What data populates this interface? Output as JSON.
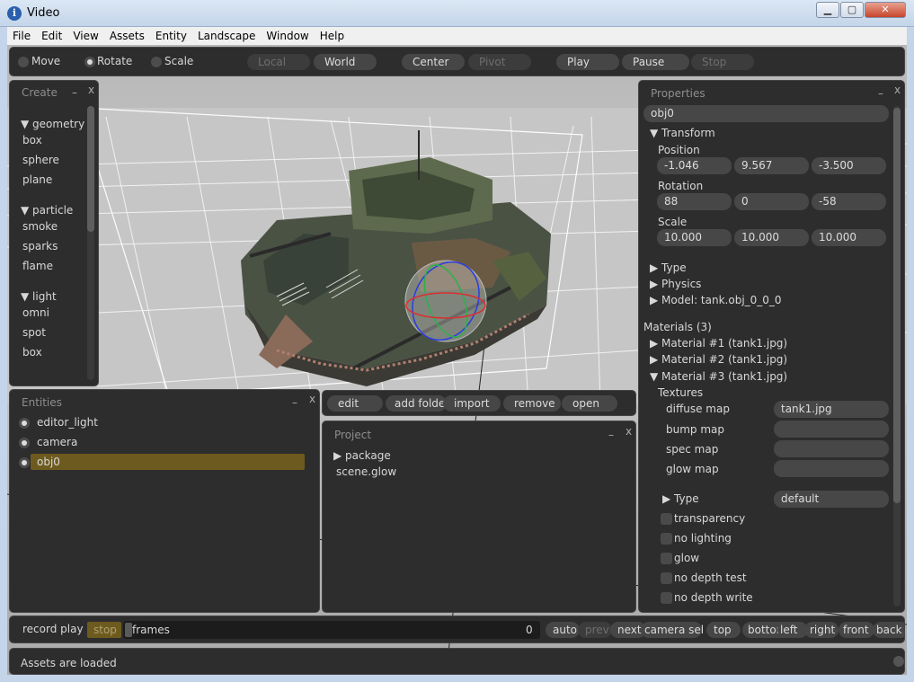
{
  "window": {
    "title": "Video",
    "min_label": "▁",
    "max_label": "▢",
    "close_label": "✕"
  },
  "menu": [
    "File",
    "Edit",
    "View",
    "Assets",
    "Entity",
    "Landscape",
    "Window",
    "Help"
  ],
  "toolbar": {
    "move": "Move",
    "rotate": "Rotate",
    "scale": "Scale",
    "local": "Local",
    "world": "World",
    "center": "Center",
    "pivot": "Pivot",
    "play": "Play",
    "pause": "Pause",
    "stop": "Stop"
  },
  "create": {
    "title": "Create",
    "min": "–",
    "close": "x",
    "groups": [
      {
        "label": "geometry",
        "items": [
          "box",
          "sphere",
          "plane"
        ]
      },
      {
        "label": "particle",
        "items": [
          "smoke",
          "sparks",
          "flame"
        ]
      },
      {
        "label": "light",
        "items": [
          "omni",
          "spot",
          "box"
        ]
      }
    ]
  },
  "entities": {
    "title": "Entities",
    "min": "–",
    "close": "x",
    "items": [
      "editor_light",
      "camera",
      "obj0"
    ],
    "selected": 2
  },
  "project_actions": [
    "edit",
    "add folder",
    "import",
    "remove",
    "open"
  ],
  "project": {
    "title": "Project",
    "min": "–",
    "close": "x",
    "folder": "package",
    "file": "scene.glow"
  },
  "properties": {
    "title": "Properties",
    "min": "–",
    "close": "x",
    "name": "obj0",
    "transform": "Transform",
    "position_label": "Position",
    "position": [
      "-1.046",
      "9.567",
      "-3.500"
    ],
    "rotation_label": "Rotation",
    "rotation": [
      "88",
      "0",
      "-58"
    ],
    "scale_label": "Scale",
    "scale": [
      "10.000",
      "10.000",
      "10.000"
    ],
    "type": "Type",
    "physics": "Physics",
    "model": "Model: tank.obj_0_0_0",
    "materials": "Materials (3)",
    "material_list": [
      "Material #1 (tank1.jpg)",
      "Material #2 (tank1.jpg)",
      "Material #3 (tank1.jpg)"
    ],
    "textures": "Textures",
    "diffuse_label": "diffuse map",
    "diffuse_value": "tank1.jpg",
    "bump_label": "bump map",
    "spec_label": "spec map",
    "glow_label": "glow map",
    "mat_type_label": "Type",
    "mat_type_value": "default",
    "flags": [
      "transparency",
      "no lighting",
      "glow",
      "no depth test",
      "no depth write"
    ]
  },
  "timeline": {
    "record_play": "record play",
    "stop": "stop",
    "frames": "frames",
    "frame_value": "0",
    "auto": "auto",
    "prev": "prev",
    "next": "next",
    "camera_sel": "camera sel",
    "top": "top",
    "bottom": "bottom",
    "left": "left",
    "right": "right",
    "front": "front",
    "back": "back"
  },
  "status": "Assets are loaded"
}
